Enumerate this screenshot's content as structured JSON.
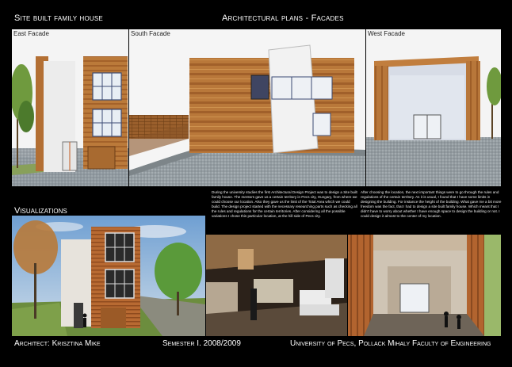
{
  "header": {
    "left_title": "Site built family house",
    "center_title": "Architectural plans - Facades"
  },
  "facades": {
    "east": "East Facade",
    "south": "South Facade",
    "west": "West Facade"
  },
  "description": {
    "left": "During the university studies the first Architectural Design Project was to design a Site built family house. The mentors gave us a certain territory in Pecs city, Hungary, from where we could choose our location. Also they gave us the limit of the Total Area which we could build. The design project started with the necessary researching parts such as checking all the rules and regulations for the certain territories. After considering all the possible variations I chose this particular location, at the hill side of Pecs city.",
    "right": "After choosing the location, the next important things were to go through the rules and regulations of the certain territory. As it is usual, I found that I have some limits in designing the building. For instance the height of the building. What gave me a bit more freedom was the fact, that I had to design a site built family house. Which meant that I didn't have to worry about whether I have enough space to design the building or not. I could design it almost to the center of my location."
  },
  "visualizations_title": "Visualizations",
  "footer": {
    "architect": "Architect: Krisztina Mike",
    "semester": "Semester I. 2008/2009",
    "university": "University of Pecs, Pollack Mihaly Faculty of Engineering"
  }
}
